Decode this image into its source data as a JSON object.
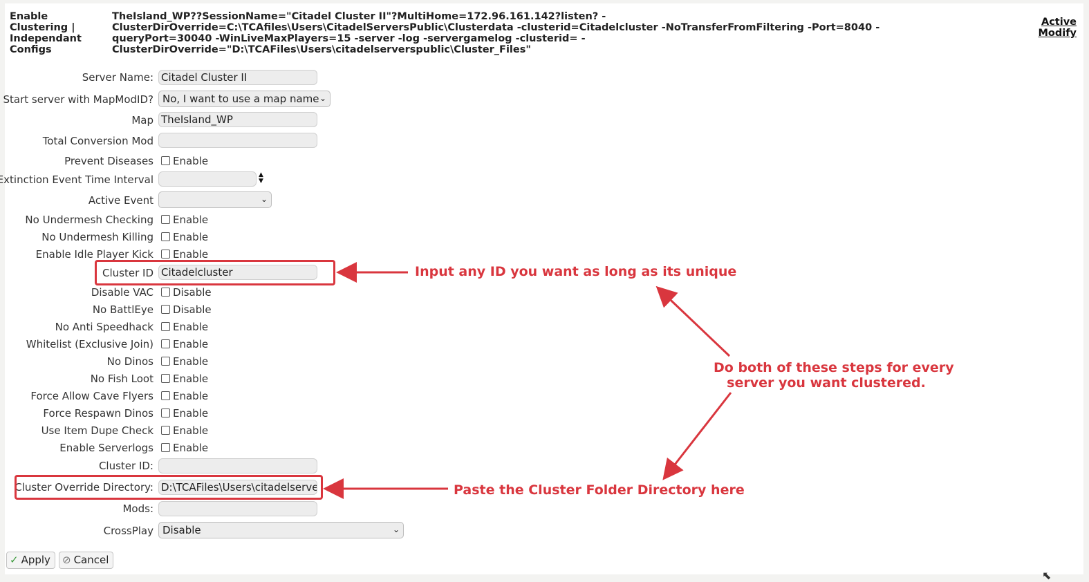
{
  "header": {
    "left_title": "Enable Clustering | Independant Configs",
    "command_line": "TheIsland_WP??SessionName=\"Citadel Cluster II\"?MultiHome=172.96.161.142?listen? -ClusterDirOverride=C:\\TCAfiles\\Users\\CitadelServersPublic\\Clusterdata -clusterid=Citadelcluster -NoTransferFromFiltering -Port=8040 -queryPort=30040 -WinLiveMaxPlayers=15 -server -log -servergamelog -clusterid= -ClusterDirOverride=\"D:\\TCAFiles\\Users\\citadelserverspublic\\Cluster_Files\"",
    "active_link": "Active",
    "modify_link": "Modify"
  },
  "form": {
    "server_name_label": "Server Name:",
    "server_name_value": "Citadel Cluster II",
    "mapmod_label": "Start server with MapModID?",
    "mapmod_value": "No, I want to use a map name",
    "map_label": "Map",
    "map_value": "TheIsland_WP",
    "tcm_label": "Total Conversion Mod",
    "tcm_value": "",
    "prevent_diseases_label": "Prevent Diseases",
    "extinction_label": "Extinction Event Time Interval",
    "extinction_value": "",
    "active_event_label": "Active Event",
    "active_event_value": "",
    "no_undermesh_checking_label": "No Undermesh Checking",
    "no_undermesh_killing_label": "No Undermesh Killing",
    "idle_kick_label": "Enable Idle Player Kick",
    "cluster_id_label": "Cluster ID",
    "cluster_id_value": "Citadelcluster",
    "disable_vac_label": "Disable VAC",
    "no_battleye_label": "No BattlEye",
    "no_anti_speedhack_label": "No Anti Speedhack",
    "whitelist_label": "Whitelist (Exclusive Join)",
    "no_dinos_label": "No Dinos",
    "no_fish_loot_label": "No Fish Loot",
    "cave_flyers_label": "Force Allow Cave Flyers",
    "respawn_dinos_label": "Force Respawn Dinos",
    "item_dupe_label": "Use Item Dupe Check",
    "serverlogs_label": "Enable Serverlogs",
    "cluster_id2_label": "Cluster ID:",
    "cluster_id2_value": "",
    "cluster_override_label": "Cluster Override Directory:",
    "cluster_override_value": "D:\\TCAFiles\\Users\\citadelserverspublic\\Cluster_Files",
    "mods_label": "Mods:",
    "mods_value": "",
    "crossplay_label": "CrossPlay",
    "crossplay_value": "Disable",
    "enable_text": "Enable",
    "disable_text": "Disable"
  },
  "buttons": {
    "apply": "Apply",
    "cancel": "Cancel"
  },
  "annotations": {
    "cluster_id_note": "Input any ID you want as long as its unique",
    "both_steps_line1": "Do both of these steps for every",
    "both_steps_line2": "server you want clustered.",
    "directory_note": "Paste the Cluster Folder Directory here"
  },
  "colors": {
    "annotation_red": "#d9363e",
    "field_bg": "#ededed"
  }
}
